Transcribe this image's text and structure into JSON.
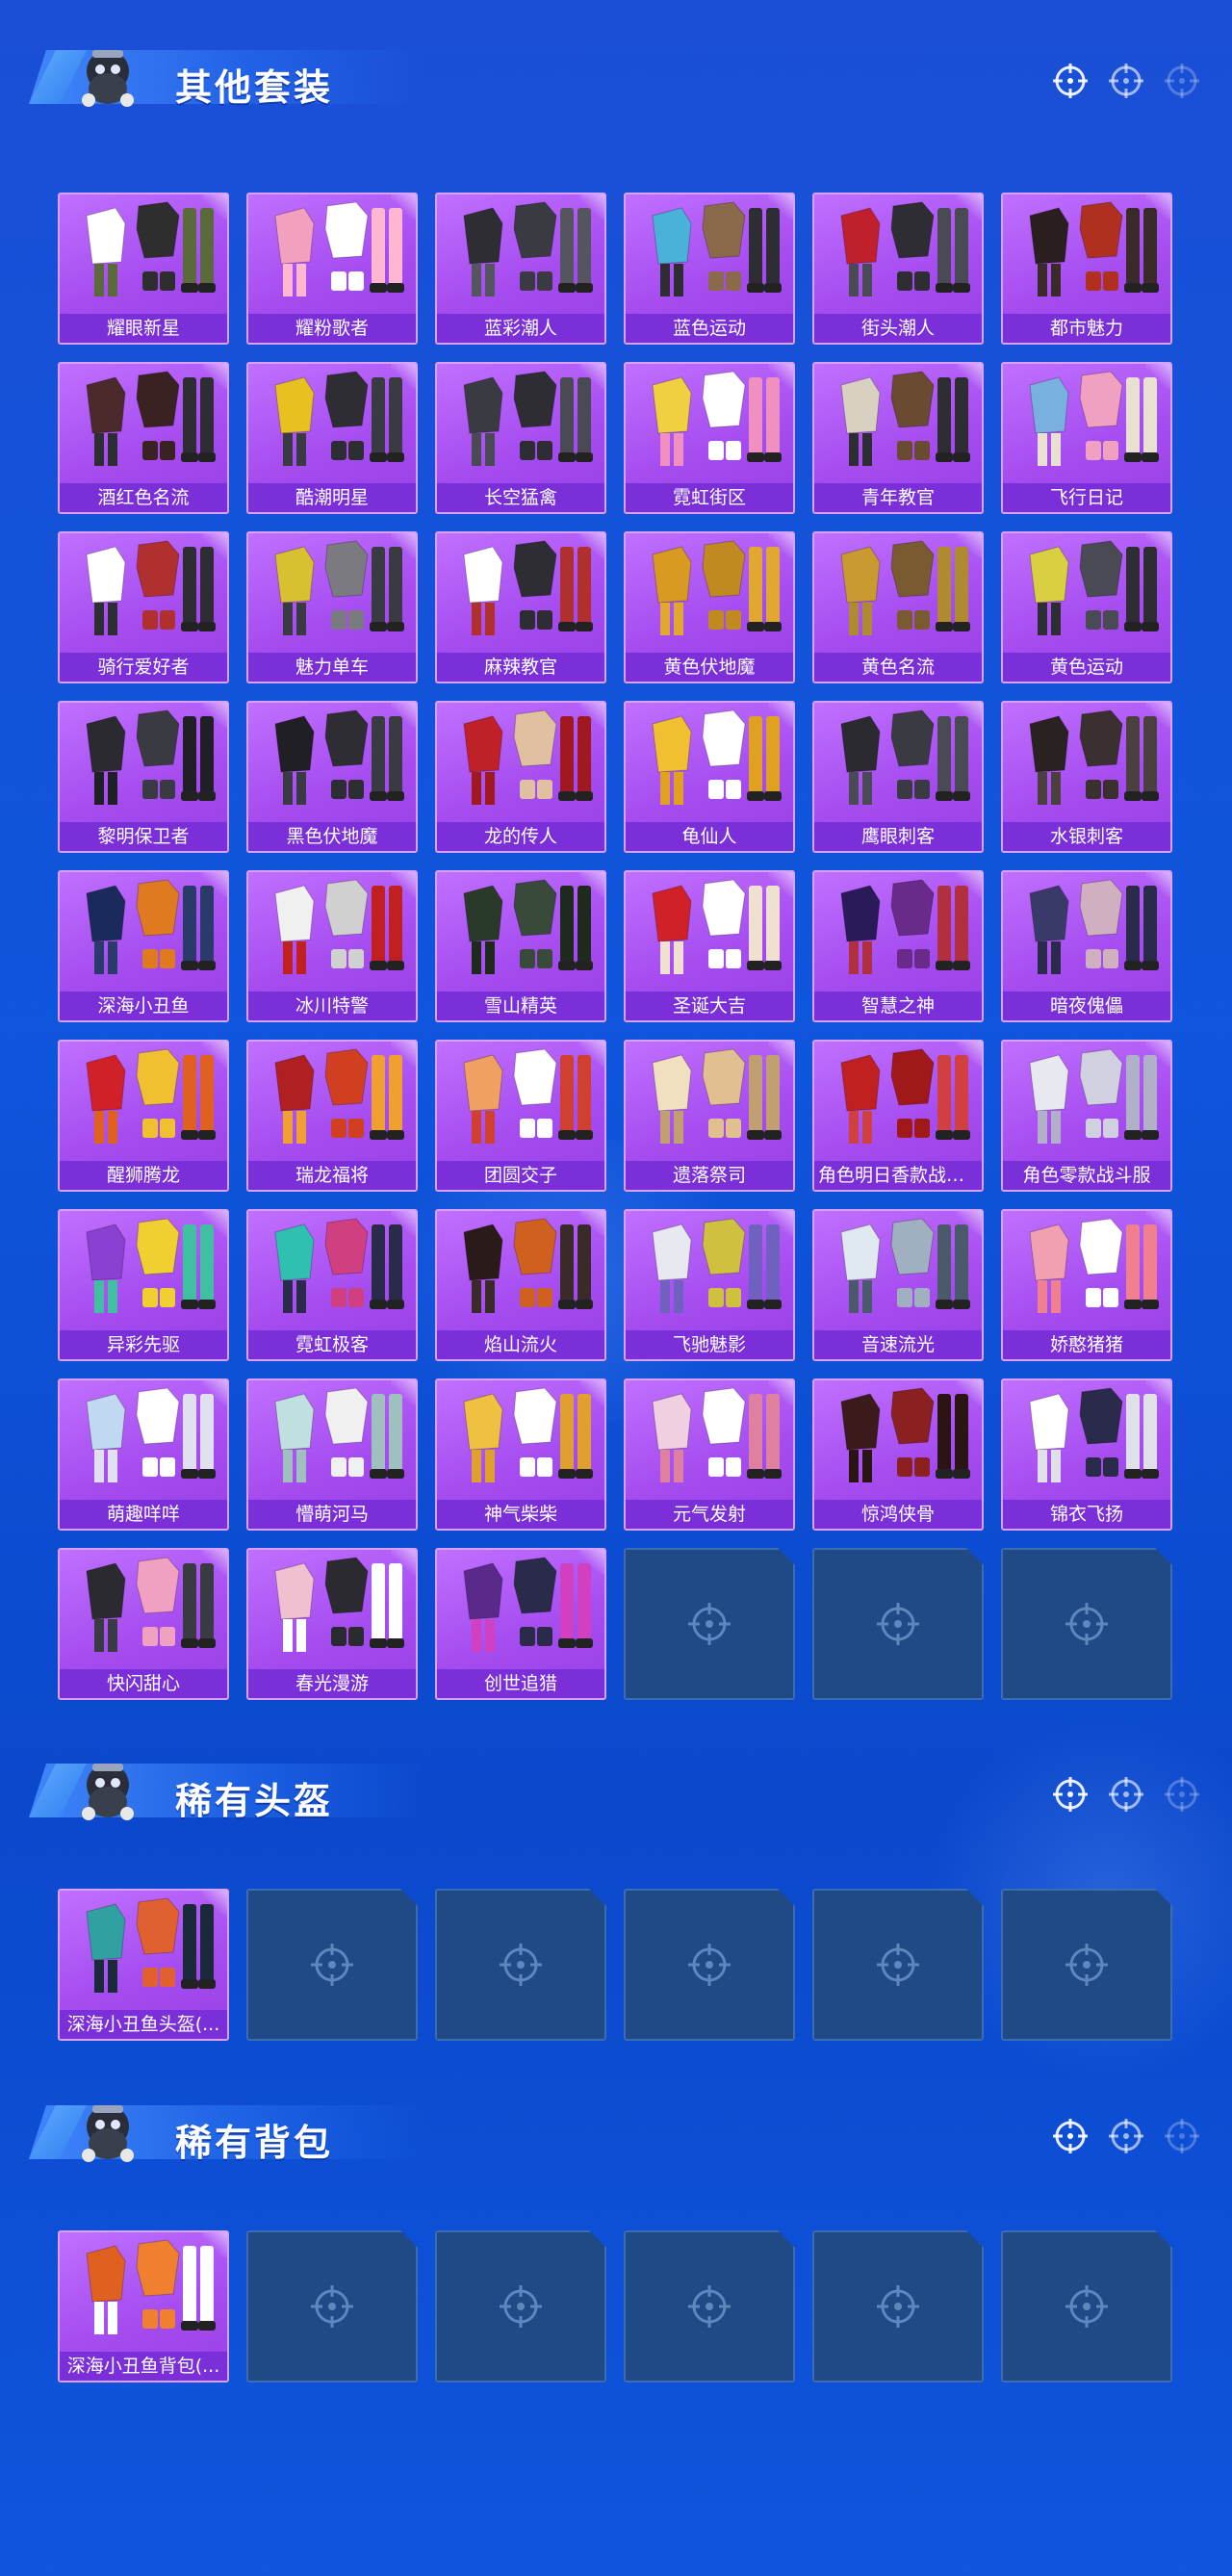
{
  "colors": {
    "page_bg": "#0f55dd",
    "card_bg": "#a64df0",
    "card_label_bg": "#7a2fd8",
    "empty_slot_bg": "#1f4a86",
    "title_text": "#ffffff"
  },
  "sections": [
    {
      "title": "其他套装",
      "items": [
        {
          "label": "耀眼新星",
          "art": [
            "#ffffff",
            "#2e2e2e",
            "#5a6a3a"
          ]
        },
        {
          "label": "耀粉歌者",
          "art": [
            "#f2a0c0",
            "#ffffff",
            "#ffb6d0"
          ]
        },
        {
          "label": "蓝彩潮人",
          "art": [
            "#2d2d33",
            "#3a3a42",
            "#555560"
          ]
        },
        {
          "label": "蓝色运动",
          "art": [
            "#4ab2d8",
            "#8a6a4a",
            "#2d2d33"
          ]
        },
        {
          "label": "街头潮人",
          "art": [
            "#c0202c",
            "#2d2d33",
            "#4a4a55"
          ]
        },
        {
          "label": "都市魅力",
          "art": [
            "#2a1e1e",
            "#b03020",
            "#3a2a2a"
          ]
        },
        {
          "label": "酒红色名流",
          "art": [
            "#4a2a2a",
            "#3a2222",
            "#2d2d33"
          ]
        },
        {
          "label": "酷潮明星",
          "art": [
            "#e8c020",
            "#2d2d33",
            "#3a3a42"
          ]
        },
        {
          "label": "长空猛禽",
          "art": [
            "#3a3a42",
            "#2d2d33",
            "#4a4a55"
          ]
        },
        {
          "label": "霓虹街区",
          "art": [
            "#f0d040",
            "#ffffff",
            "#f090c0"
          ]
        },
        {
          "label": "青年教官",
          "art": [
            "#d8d0c0",
            "#6a4a30",
            "#2d2d33"
          ]
        },
        {
          "label": "飞行日记",
          "art": [
            "#7ab0e0",
            "#f0a0c0",
            "#e8e0d0"
          ]
        },
        {
          "label": "骑行爱好者",
          "art": [
            "#ffffff",
            "#b03030",
            "#2d2d33"
          ]
        },
        {
          "label": "魅力单车",
          "art": [
            "#d8c030",
            "#7a7a80",
            "#3a3a42"
          ]
        },
        {
          "label": "麻辣教官",
          "art": [
            "#ffffff",
            "#2d2d33",
            "#b03030"
          ]
        },
        {
          "label": "黄色伏地魔",
          "art": [
            "#d89a20",
            "#c08a20",
            "#e0a830"
          ]
        },
        {
          "label": "黄色名流",
          "art": [
            "#c89a30",
            "#7a5a30",
            "#b08a30"
          ]
        },
        {
          "label": "黄色运动",
          "art": [
            "#d8d040",
            "#4a4a55",
            "#2d2d33"
          ]
        },
        {
          "label": "黎明保卫者",
          "art": [
            "#2a2a30",
            "#3a3a42",
            "#1f1f25"
          ]
        },
        {
          "label": "黑色伏地魔",
          "art": [
            "#1f1f25",
            "#2d2d33",
            "#3a3a42"
          ]
        },
        {
          "label": "龙的传人",
          "art": [
            "#c02028",
            "#e0c0a0",
            "#a01820"
          ]
        },
        {
          "label": "龟仙人",
          "art": [
            "#f0c030",
            "#ffffff",
            "#e0a020"
          ]
        },
        {
          "label": "鹰眼刺客",
          "art": [
            "#2a2a30",
            "#3a3a42",
            "#4a4a55"
          ]
        },
        {
          "label": "水银刺客",
          "art": [
            "#2a2220",
            "#3a3030",
            "#4a4040"
          ]
        },
        {
          "label": "深海小丑鱼",
          "art": [
            "#1a2a5a",
            "#e07a20",
            "#2a3a6a"
          ]
        },
        {
          "label": "冰川特警",
          "art": [
            "#f0f0f0",
            "#d0d0d0",
            "#c02020"
          ]
        },
        {
          "label": "雪山精英",
          "art": [
            "#2a3a2a",
            "#3a4a3a",
            "#1f2a1f"
          ]
        },
        {
          "label": "圣诞大吉",
          "art": [
            "#d02028",
            "#ffffff",
            "#f0e0d0"
          ]
        },
        {
          "label": "智慧之神",
          "art": [
            "#2a1a5a",
            "#6a2a8a",
            "#b03040"
          ]
        },
        {
          "label": "暗夜傀儡",
          "art": [
            "#3a3a6a",
            "#d0b0c0",
            "#2a2a4a"
          ]
        },
        {
          "label": "醒狮腾龙",
          "art": [
            "#d02028",
            "#f0c030",
            "#e06020"
          ]
        },
        {
          "label": "瑞龙福将",
          "art": [
            "#b02020",
            "#d04020",
            "#f0a030"
          ]
        },
        {
          "label": "团圆交子",
          "art": [
            "#f0a060",
            "#ffffff",
            "#d04030"
          ]
        },
        {
          "label": "遗落祭司",
          "art": [
            "#f0e0c0",
            "#e0c090",
            "#c0a070"
          ]
        },
        {
          "label": "角色明日香款战斗服",
          "art": [
            "#c02020",
            "#a01818",
            "#d04040"
          ]
        },
        {
          "label": "角色零款战斗服",
          "art": [
            "#e8e8f0",
            "#d0d0e0",
            "#b0b0c8"
          ]
        },
        {
          "label": "异彩先驱",
          "art": [
            "#8a40d0",
            "#f0d030",
            "#40c0a0"
          ]
        },
        {
          "label": "霓虹极客",
          "art": [
            "#30c0b0",
            "#d04080",
            "#2a2a4a"
          ]
        },
        {
          "label": "焰山流火",
          "art": [
            "#2a1a1a",
            "#d06020",
            "#3a2a2a"
          ]
        },
        {
          "label": "飞驰魅影",
          "art": [
            "#e8e8f0",
            "#d0c040",
            "#7060c0"
          ]
        },
        {
          "label": "音速流光",
          "art": [
            "#e0e8f0",
            "#a0b0c0",
            "#4a5a6a"
          ]
        },
        {
          "label": "娇憨猪猪",
          "art": [
            "#f0a0b0",
            "#ffffff",
            "#f08090"
          ]
        },
        {
          "label": "萌趣咩咩",
          "art": [
            "#c0d8f0",
            "#ffffff",
            "#e0e0f0"
          ]
        },
        {
          "label": "懵萌河马",
          "art": [
            "#c0e0e0",
            "#f0f0f0",
            "#a0c0c0"
          ]
        },
        {
          "label": "神气柴柴",
          "art": [
            "#f0c040",
            "#ffffff",
            "#e0a030"
          ]
        },
        {
          "label": "元气发射",
          "art": [
            "#f0d0e0",
            "#ffffff",
            "#e080a0"
          ]
        },
        {
          "label": "惊鸿侠骨",
          "art": [
            "#3a1a1a",
            "#8a2020",
            "#2a1414"
          ]
        },
        {
          "label": "锦衣飞扬",
          "art": [
            "#ffffff",
            "#2a2a4a",
            "#e0e0e8"
          ]
        },
        {
          "label": "快闪甜心",
          "art": [
            "#2a2a30",
            "#f0a0c0",
            "#3a3a42"
          ]
        },
        {
          "label": "春光漫游",
          "art": [
            "#f0c0d0",
            "#2a2a30",
            "#ffffff"
          ]
        },
        {
          "label": "创世追猎",
          "art": [
            "#5a2a8a",
            "#2a2a4a",
            "#d040c0"
          ]
        }
      ],
      "empty_slots": 3
    },
    {
      "title": "稀有头盔",
      "items": [
        {
          "label": "深海小丑鱼头盔(...",
          "art": [
            "#30a0a0",
            "#e06030",
            "#1a2a3a"
          ]
        }
      ],
      "empty_slots": 5
    },
    {
      "title": "稀有背包",
      "items": [
        {
          "label": "深海小丑鱼背包(...",
          "art": [
            "#e06020",
            "#f08030",
            "#ffffff"
          ]
        }
      ],
      "empty_slots": 5
    }
  ]
}
